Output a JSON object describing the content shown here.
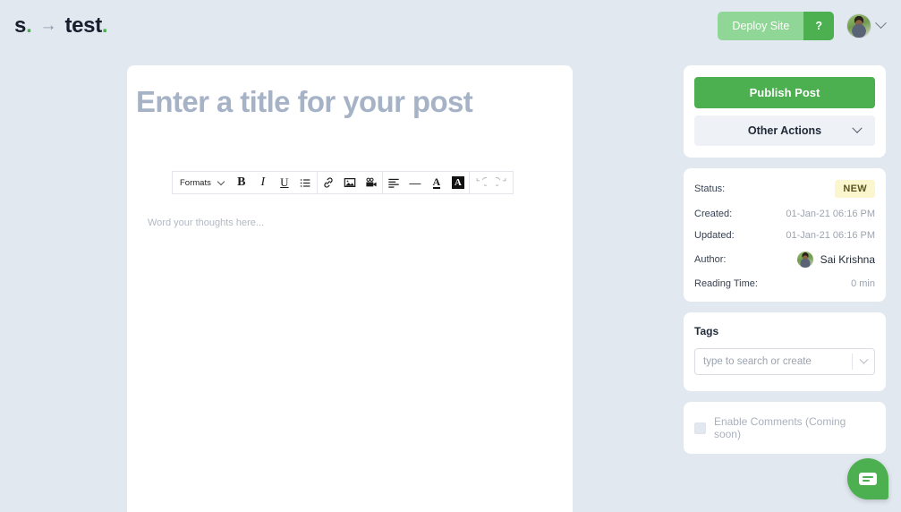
{
  "header": {
    "brand_left": "s",
    "brand_left_dot": ".",
    "arrow": "→",
    "brand_right": "test",
    "brand_right_dot": ".",
    "deploy_label": "Deploy Site",
    "help_label": "?",
    "avatar_name": "user-avatar"
  },
  "editor": {
    "title_placeholder": "Enter a title for your post",
    "body_placeholder": "Word your thoughts here...",
    "toolbar": {
      "formats_label": "Formats",
      "bold": "B",
      "italic": "I",
      "underline": "U",
      "list": "☰",
      "link": "link",
      "image": "image",
      "video": "video",
      "align": "align-left",
      "hr": "—",
      "text_color": "A",
      "bg_color": "A",
      "undo": "↺",
      "redo": "↻"
    }
  },
  "sidebar": {
    "actions": {
      "publish_label": "Publish Post",
      "other_actions_label": "Other Actions"
    },
    "meta": [
      {
        "label": "Status:",
        "value": "NEW",
        "type": "badge"
      },
      {
        "label": "Created:",
        "value": "01-Jan-21 06:16 PM",
        "type": "text"
      },
      {
        "label": "Updated:",
        "value": "01-Jan-21 06:16 PM",
        "type": "text"
      },
      {
        "label": "Author:",
        "value": "Sai Krishna",
        "type": "author"
      },
      {
        "label": "Reading Time:",
        "value": "0 min",
        "type": "text"
      }
    ],
    "tags": {
      "title": "Tags",
      "placeholder": "type to search or create"
    },
    "comments": {
      "label": "Enable Comments (Coming soon)"
    }
  },
  "colors": {
    "background": "#e2e8f0",
    "accent_green": "#4caf50",
    "accent_green_muted": "#90d697",
    "badge_bg": "#fcf6cf",
    "badge_text": "#5b5524",
    "placeholder_title": "#a6b3c6"
  }
}
